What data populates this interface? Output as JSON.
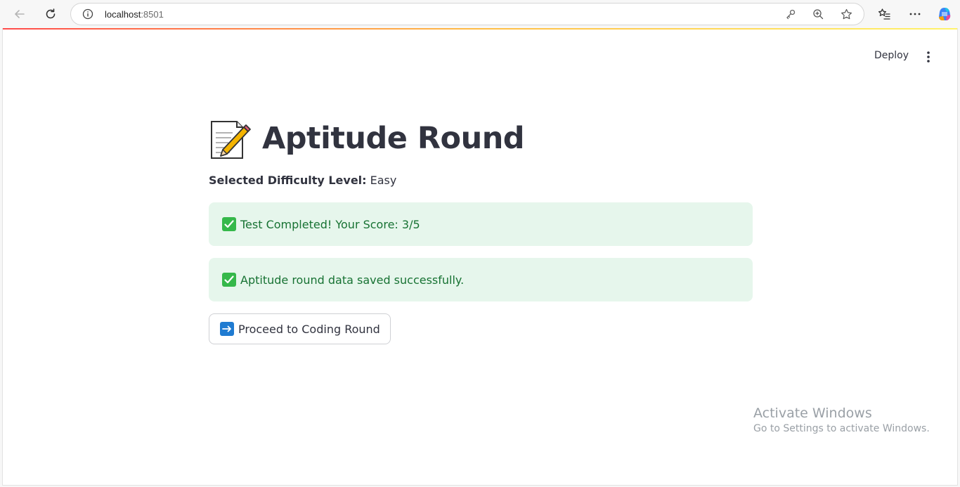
{
  "browser": {
    "url_host": "localhost",
    "url_port": ":8501"
  },
  "toolbar": {
    "deploy_label": "Deploy"
  },
  "main": {
    "title": "Aptitude Round",
    "difficulty_label": "Selected Difficulty Level:",
    "difficulty_value": "Easy",
    "alerts": [
      "Test Completed! Your Score: 3/5",
      "Aptitude round data saved successfully."
    ],
    "proceed_label": "Proceed to Coding Round"
  },
  "watermark": {
    "line1": "Activate Windows",
    "line2": "Go to Settings to activate Windows."
  },
  "colors": {
    "accent_green": "#177233",
    "alert_bg": "#e6f6ec",
    "text": "#31333f",
    "arrow_blue": "#1f7bd1"
  }
}
